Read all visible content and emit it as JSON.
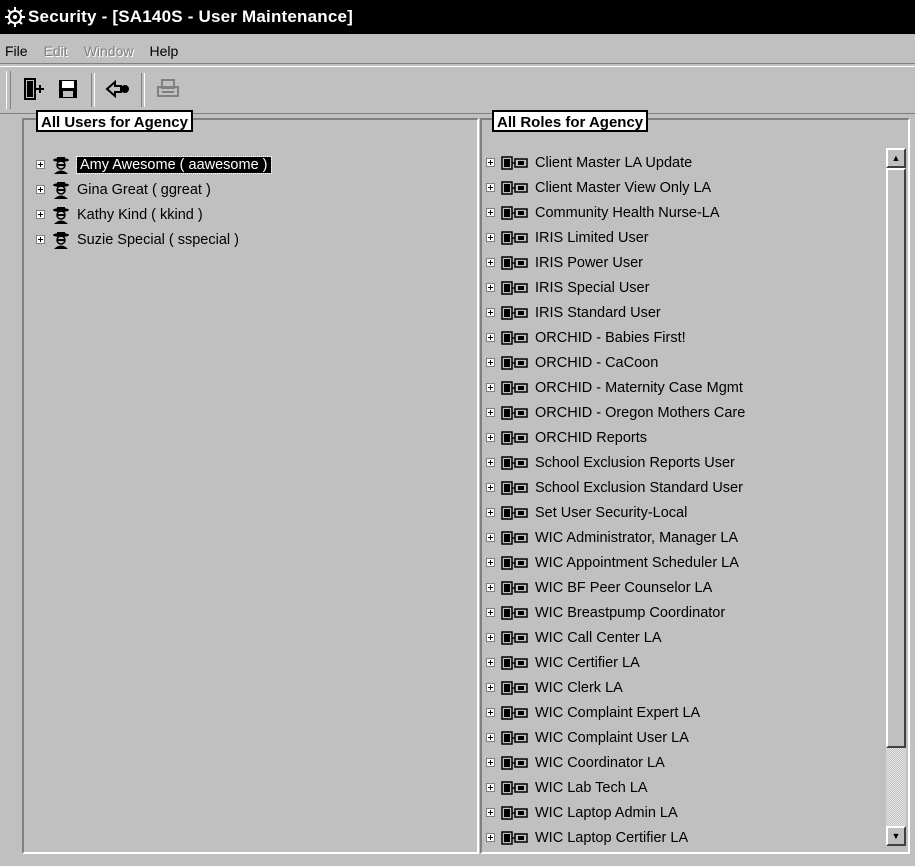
{
  "window": {
    "title": "Security - [SA140S - User Maintenance]"
  },
  "menu": [
    {
      "label": "File",
      "enabled": true
    },
    {
      "label": "Edit",
      "enabled": false
    },
    {
      "label": "Window",
      "enabled": false
    },
    {
      "label": "Help",
      "enabled": true
    }
  ],
  "toolbar": {
    "buttons": [
      {
        "icon": "exit-door-icon",
        "enabled": true
      },
      {
        "icon": "save-floppy-icon",
        "enabled": true
      },
      {
        "icon": "back-arrow-icon",
        "enabled": true
      },
      {
        "icon": "printer-icon",
        "enabled": false
      }
    ]
  },
  "users_panel": {
    "title": "All Users for Agency",
    "items": [
      {
        "label": "Amy Awesome ( aawesome )",
        "selected": true
      },
      {
        "label": "Gina Great ( ggreat )",
        "selected": false
      },
      {
        "label": "Kathy Kind ( kkind )",
        "selected": false
      },
      {
        "label": "Suzie Special ( sspecial )",
        "selected": false
      }
    ]
  },
  "roles_panel": {
    "title": "All Roles for Agency",
    "items": [
      {
        "label": "Client Master LA Update"
      },
      {
        "label": "Client Master View Only LA"
      },
      {
        "label": "Community Health Nurse-LA"
      },
      {
        "label": "IRIS Limited User"
      },
      {
        "label": "IRIS Power User"
      },
      {
        "label": "IRIS Special User"
      },
      {
        "label": "IRIS Standard User"
      },
      {
        "label": "ORCHID - Babies First!"
      },
      {
        "label": "ORCHID - CaCoon"
      },
      {
        "label": "ORCHID - Maternity Case Mgmt"
      },
      {
        "label": "ORCHID - Oregon Mothers Care"
      },
      {
        "label": "ORCHID Reports"
      },
      {
        "label": "School Exclusion Reports User"
      },
      {
        "label": "School Exclusion Standard User"
      },
      {
        "label": "Set User Security-Local"
      },
      {
        "label": "WIC Administrator, Manager LA"
      },
      {
        "label": "WIC Appointment Scheduler LA"
      },
      {
        "label": "WIC BF Peer Counselor LA"
      },
      {
        "label": "WIC Breastpump Coordinator"
      },
      {
        "label": "WIC Call Center LA"
      },
      {
        "label": "WIC Certifier LA"
      },
      {
        "label": "WIC Clerk LA"
      },
      {
        "label": "WIC Complaint Expert LA"
      },
      {
        "label": "WIC Complaint User LA"
      },
      {
        "label": "WIC Coordinator LA"
      },
      {
        "label": "WIC Lab Tech LA"
      },
      {
        "label": "WIC Laptop Admin LA"
      },
      {
        "label": "WIC Laptop Certifier LA"
      }
    ]
  }
}
